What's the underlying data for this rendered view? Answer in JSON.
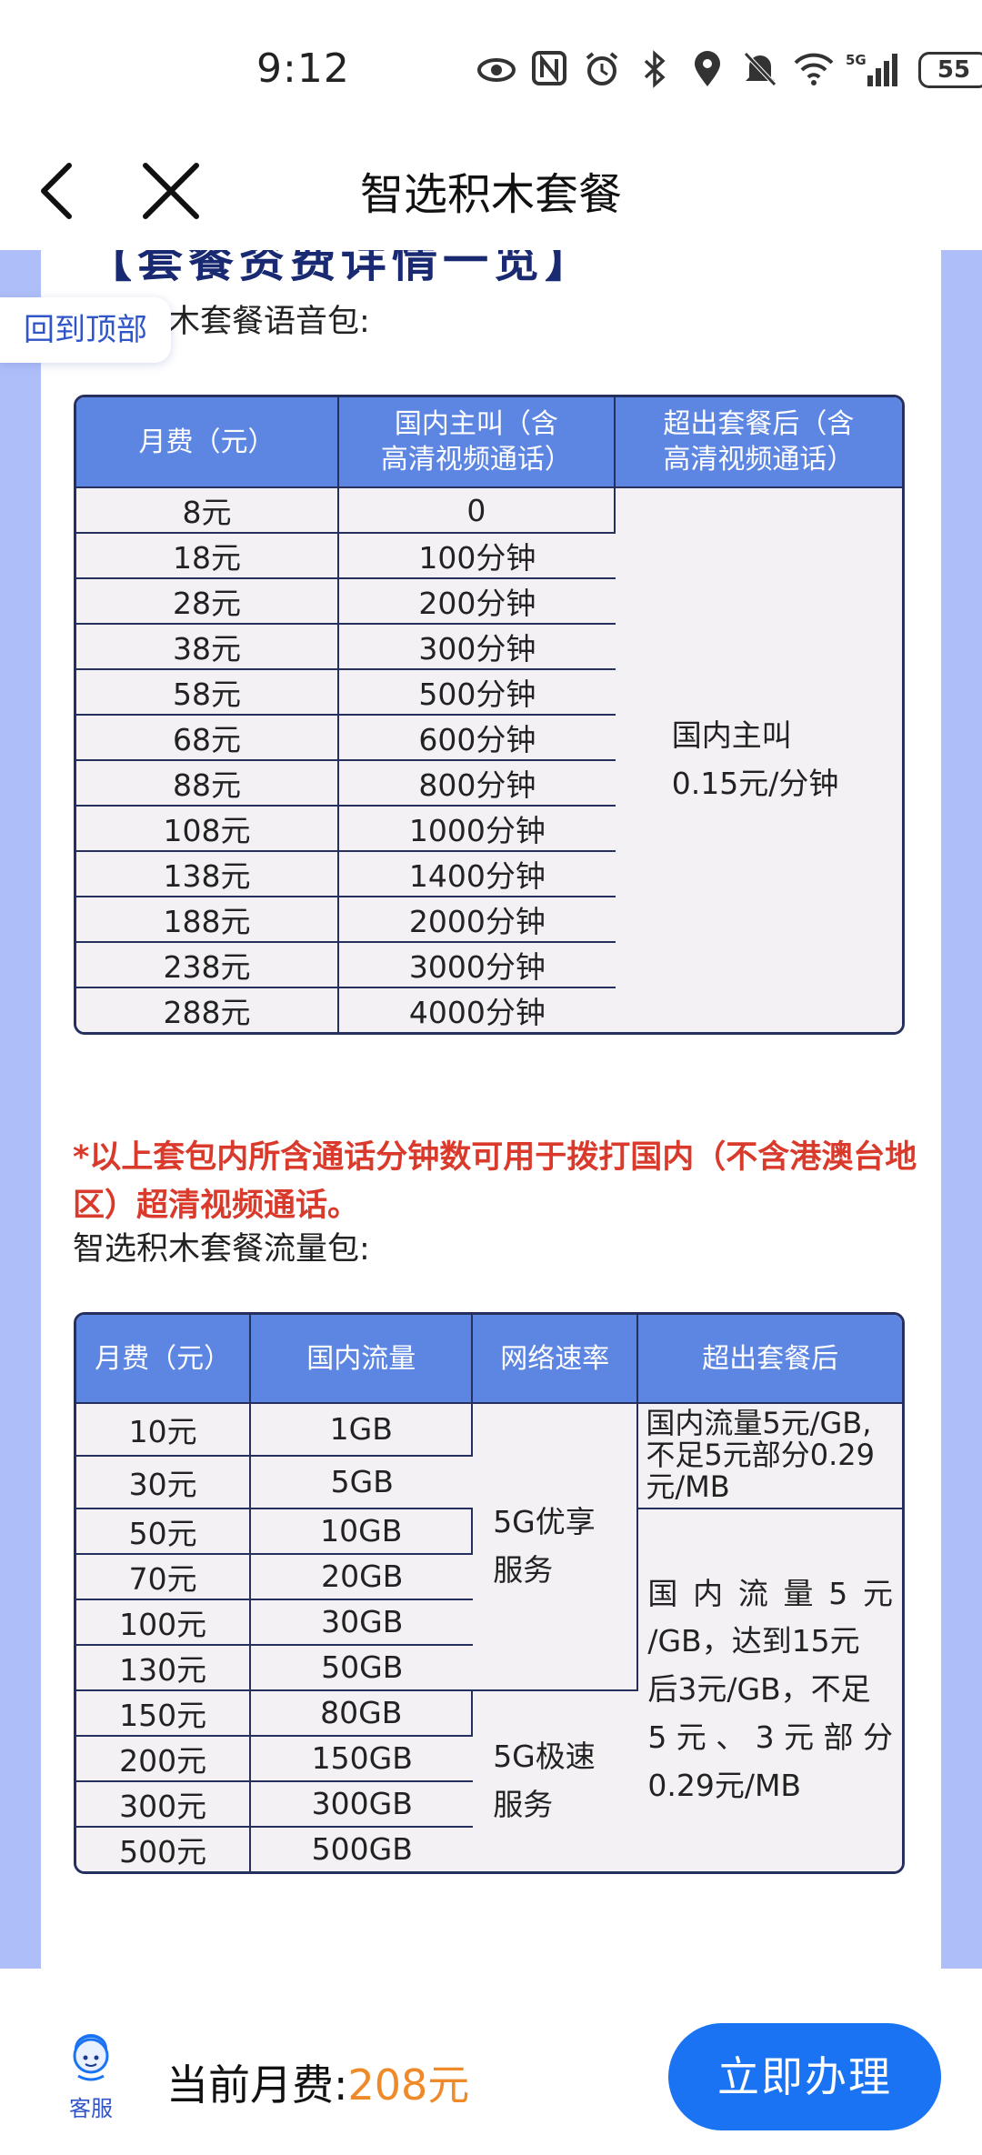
{
  "status_bar": {
    "time": "9:12",
    "icons": [
      "eye-icon",
      "nfc-icon",
      "alarm-icon",
      "bluetooth-icon",
      "location-icon",
      "mute-icon",
      "wifi-icon",
      "signal-5g-icon"
    ],
    "network": "5G",
    "battery": "55"
  },
  "header": {
    "title": "智选积木套餐"
  },
  "content": {
    "cut_heading": "【套餐资费详情一览】",
    "back_to_top": "回到顶部",
    "voice_label": "智选积木套餐语音包:",
    "voice_table": {
      "headers": [
        "月费（元）",
        "国内主叫（含\n高清视频通话）",
        "超出套餐后（含\n高清视频通话）"
      ],
      "rows": [
        [
          "8元",
          "0"
        ],
        [
          "18元",
          "100分钟"
        ],
        [
          "28元",
          "200分钟"
        ],
        [
          "38元",
          "300分钟"
        ],
        [
          "58元",
          "500分钟"
        ],
        [
          "68元",
          "600分钟"
        ],
        [
          "88元",
          "800分钟"
        ],
        [
          "108元",
          "1000分钟"
        ],
        [
          "138元",
          "1400分钟"
        ],
        [
          "188元",
          "2000分钟"
        ],
        [
          "238元",
          "3000分钟"
        ],
        [
          "288元",
          "4000分钟"
        ]
      ],
      "overage_line1": "国内主叫",
      "overage_line2": "0.15元/分钟"
    },
    "notice": "*以上套包内所含通话分钟数可用于拨打国内（不含港澳台地区）超清视频通话。",
    "data_label": "智选积木套餐流量包:",
    "data_table": {
      "headers": [
        "月费（元）",
        "国内流量",
        "网络速率",
        "超出套餐后"
      ],
      "rows": [
        [
          "10元",
          "1GB"
        ],
        [
          "30元",
          "5GB"
        ],
        [
          "50元",
          "10GB"
        ],
        [
          "70元",
          "20GB"
        ],
        [
          "100元",
          "30GB"
        ],
        [
          "130元",
          "50GB"
        ],
        [
          "150元",
          "80GB"
        ],
        [
          "200元",
          "150GB"
        ],
        [
          "300元",
          "300GB"
        ],
        [
          "500元",
          "500GB"
        ]
      ],
      "speed_1_line1": "5G优享",
      "speed_1_line2": "服务",
      "speed_2_line1": "5G极速",
      "speed_2_line2": "服务",
      "overage_1_line1": "国内流量5元/GB,",
      "overage_1_line2": "不足5元部分0.29",
      "overage_1_line3": "元/MB",
      "overage_2_line1": "国内流量5元",
      "overage_2_line2": "/GB，达到15元",
      "overage_2_line3": "后3元/GB，不足",
      "overage_2_line4": "5元、3元部分",
      "overage_2_line5": "0.29元/MB"
    }
  },
  "bottom_bar": {
    "service_label": "客服",
    "fee_label": "当前月费:",
    "fee_value": "208元",
    "apply_label": "立即办理"
  },
  "colors": {
    "header_blue": "#5d86e3",
    "border_navy": "#25305f",
    "accent_blue": "#1a73f2",
    "warning_red": "#d93a2b",
    "fee_orange": "#ef8a2a",
    "side_lavender": "#aebef9"
  }
}
